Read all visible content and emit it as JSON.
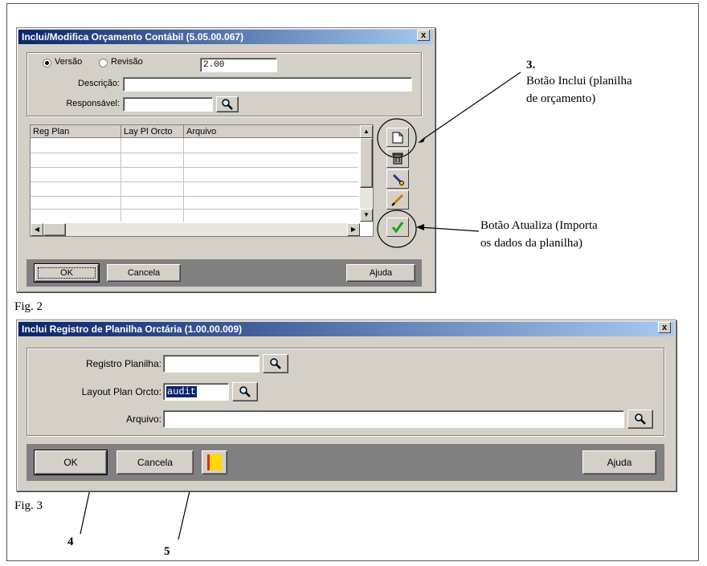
{
  "fig2": {
    "title": "Inclui/Modifica Orçamento Contábil (5.05.00.067)",
    "close": "x",
    "radio_versao": "Versão",
    "radio_revisao": "Revisão",
    "version_value": "2.00",
    "descricao_label": "Descrição:",
    "descricao_value": "",
    "responsavel_label": "Responsável:",
    "responsavel_value": "",
    "grid_headers": [
      "Reg Plan",
      "Lay Pl Orcto",
      "Arquivo"
    ],
    "ok": "OK",
    "cancela": "Cancela",
    "ajuda": "Ajuda",
    "caption": "Fig. 2"
  },
  "fig3": {
    "title": "Inclui Registro de Planilha Orctária (1.00.00.009)",
    "close": "x",
    "registro_label": "Registro Planilha:",
    "registro_value": "",
    "layout_label": "Layout Plan Orcto:",
    "layout_value": "audit",
    "arquivo_label": "Arquivo:",
    "arquivo_value": "",
    "ok": "OK",
    "cancela": "Cancela",
    "ajuda": "Ajuda",
    "caption": "Fig. 3"
  },
  "annotations": {
    "num3": "3.",
    "inclui_line1": "Botão Inclui (planilha",
    "inclui_line2": "de orçamento)",
    "atualiza_line1": "Botão Atualiza (Importa",
    "atualiza_line2": "os dados da planilha)",
    "num4": "4",
    "num5": "5"
  },
  "colors": {
    "title_start": "#0a246a",
    "title_end": "#a6caf0",
    "face": "#d4d0c8"
  }
}
